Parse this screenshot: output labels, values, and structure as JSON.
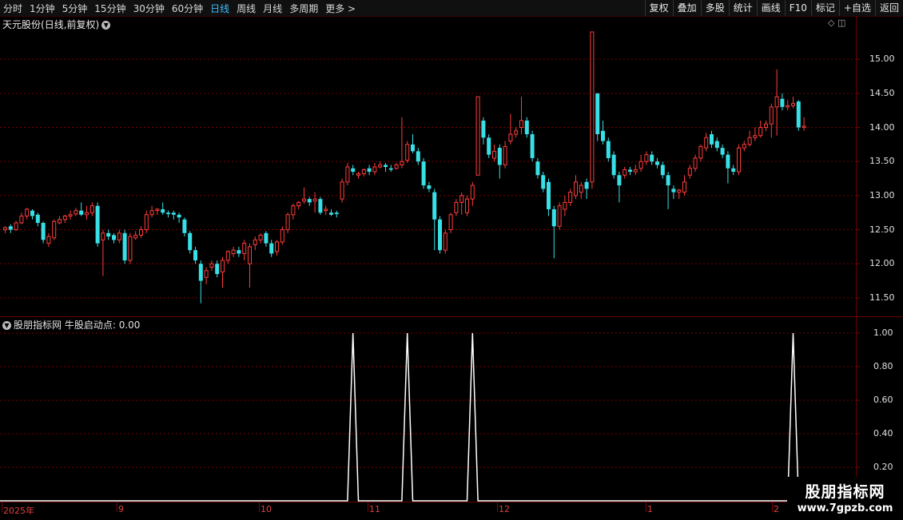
{
  "toolbar": {
    "periods": [
      "分时",
      "1分钟",
      "5分钟",
      "15分钟",
      "30分钟",
      "60分钟",
      "日线",
      "周线",
      "月线",
      "多周期",
      "更多 >"
    ],
    "active_period": "日线",
    "buttons": [
      "复权",
      "叠加",
      "多股",
      "统计",
      "画线",
      "F10",
      "标记",
      "+自选",
      "返回"
    ]
  },
  "stock": {
    "name": "天元股份",
    "chart_mode": "(日线,前复权)"
  },
  "price_axis": {
    "labels": [
      "15.00",
      "14.50",
      "14.00",
      "13.50",
      "13.00",
      "12.50",
      "12.00",
      "11.50"
    ],
    "min": 11.3,
    "max": 15.4
  },
  "indicator": {
    "name": "股朋指标网",
    "series_label": "牛股启动点: 0.00",
    "axis_labels": [
      "1.00",
      "0.80",
      "0.60",
      "0.40",
      "0.20"
    ]
  },
  "time_axis": {
    "labels": [
      "2025年",
      "9",
      "10",
      "11",
      "12",
      "1",
      "2"
    ]
  },
  "watermark": {
    "main": "股朋指标网",
    "url": "www.7gpzb.com"
  },
  "colors": {
    "up": "#ff3c3c",
    "down": "#37e0e6",
    "doji": "#ffffff",
    "indicator": "#ffffff",
    "grid": "#7a0000",
    "background": "#000000"
  },
  "chart_data": {
    "type": "candlestick",
    "series": [
      {
        "name": "K线",
        "ohlc": [
          [
            12.5,
            12.53,
            12.45,
            12.55
          ],
          [
            12.55,
            12.5,
            12.45,
            12.58
          ],
          [
            12.5,
            12.6,
            12.48,
            12.63
          ],
          [
            12.6,
            12.7,
            12.58,
            12.75
          ],
          [
            12.7,
            12.8,
            12.65,
            12.82
          ],
          [
            12.78,
            12.7,
            12.65,
            12.8
          ],
          [
            12.72,
            12.6,
            12.55,
            12.75
          ],
          [
            12.6,
            12.35,
            12.3,
            12.62
          ],
          [
            12.3,
            12.4,
            12.25,
            12.45
          ],
          [
            12.38,
            12.62,
            12.35,
            12.65
          ],
          [
            12.6,
            12.65,
            12.58,
            12.7
          ],
          [
            12.65,
            12.7,
            12.6,
            12.72
          ],
          [
            12.7,
            12.72,
            12.65,
            12.78
          ],
          [
            12.73,
            12.78,
            12.7,
            12.82
          ],
          [
            12.78,
            12.72,
            12.7,
            12.9
          ],
          [
            12.72,
            12.75,
            12.65,
            12.85
          ],
          [
            12.75,
            12.85,
            12.7,
            12.9
          ],
          [
            12.85,
            12.3,
            12.25,
            12.9
          ],
          [
            12.35,
            12.45,
            11.82,
            12.5
          ],
          [
            12.45,
            12.4,
            12.35,
            12.5
          ],
          [
            12.42,
            12.35,
            12.3,
            12.45
          ],
          [
            12.35,
            12.45,
            12.3,
            12.5
          ],
          [
            12.45,
            12.05,
            12.0,
            12.5
          ],
          [
            12.05,
            12.4,
            12.0,
            12.45
          ],
          [
            12.38,
            12.42,
            12.35,
            12.48
          ],
          [
            12.42,
            12.5,
            12.38,
            12.55
          ],
          [
            12.5,
            12.72,
            12.45,
            12.78
          ],
          [
            12.72,
            12.78,
            12.68,
            12.85
          ],
          [
            12.78,
            12.8,
            12.72,
            12.82
          ],
          [
            12.8,
            12.75,
            12.72,
            12.9
          ],
          [
            12.75,
            12.73,
            12.68,
            12.78
          ],
          [
            12.75,
            12.72,
            12.65,
            12.78
          ],
          [
            12.72,
            12.68,
            12.6,
            12.75
          ],
          [
            12.65,
            12.45,
            12.4,
            12.68
          ],
          [
            12.45,
            12.2,
            12.15,
            12.48
          ],
          [
            12.2,
            12.05,
            12.0,
            12.25
          ],
          [
            12.0,
            11.75,
            11.42,
            12.05
          ],
          [
            11.8,
            11.9,
            11.7,
            11.95
          ],
          [
            11.95,
            12.0,
            11.9,
            12.05
          ],
          [
            12.0,
            11.85,
            11.8,
            12.05
          ],
          [
            11.88,
            12.05,
            11.65,
            12.1
          ],
          [
            12.05,
            12.18,
            12.0,
            12.2
          ],
          [
            12.15,
            12.2,
            12.1,
            12.25
          ],
          [
            12.2,
            12.15,
            12.1,
            12.25
          ],
          [
            12.15,
            12.3,
            12.05,
            12.35
          ],
          [
            12.0,
            12.25,
            11.65,
            12.3
          ],
          [
            12.28,
            12.35,
            12.2,
            12.4
          ],
          [
            12.35,
            12.42,
            12.3,
            12.45
          ],
          [
            12.45,
            12.3,
            12.25,
            12.48
          ],
          [
            12.3,
            12.15,
            12.1,
            12.35
          ],
          [
            12.18,
            12.32,
            12.12,
            12.35
          ],
          [
            12.32,
            12.5,
            12.28,
            12.55
          ],
          [
            12.5,
            12.72,
            12.45,
            12.75
          ],
          [
            12.72,
            12.85,
            12.65,
            12.88
          ],
          [
            12.85,
            12.9,
            12.8,
            12.92
          ],
          [
            12.92,
            12.95,
            12.88,
            13.12
          ],
          [
            12.95,
            12.9,
            12.85,
            12.98
          ],
          [
            12.92,
            12.95,
            12.75,
            13.05
          ],
          [
            12.95,
            12.75,
            12.72,
            12.98
          ],
          [
            12.78,
            12.8,
            12.72,
            12.85
          ],
          [
            12.75,
            12.72,
            12.7,
            12.8
          ],
          [
            12.75,
            12.73,
            12.68,
            12.78
          ],
          [
            12.95,
            13.2,
            12.9,
            13.25
          ],
          [
            13.2,
            13.42,
            13.15,
            13.48
          ],
          [
            13.4,
            13.35,
            13.3,
            13.45
          ],
          [
            13.3,
            13.32,
            13.25,
            13.35
          ],
          [
            13.32,
            13.38,
            13.28,
            13.4
          ],
          [
            13.4,
            13.35,
            13.3,
            13.45
          ],
          [
            13.35,
            13.42,
            13.3,
            13.48
          ],
          [
            13.42,
            13.45,
            13.4,
            13.5
          ],
          [
            13.45,
            13.42,
            13.35,
            13.48
          ],
          [
            13.4,
            13.38,
            13.35,
            13.45
          ],
          [
            13.4,
            13.45,
            13.38,
            13.48
          ],
          [
            13.45,
            13.5,
            13.4,
            14.15
          ],
          [
            13.52,
            13.75,
            13.48,
            13.8
          ],
          [
            13.75,
            13.65,
            13.62,
            13.9
          ],
          [
            13.65,
            13.5,
            13.45,
            13.7
          ],
          [
            13.5,
            13.15,
            13.1,
            13.55
          ],
          [
            13.15,
            13.1,
            13.05,
            13.2
          ],
          [
            13.05,
            12.65,
            12.2,
            13.1
          ],
          [
            12.65,
            12.2,
            12.15,
            12.7
          ],
          [
            12.2,
            12.45,
            12.15,
            12.5
          ],
          [
            12.5,
            12.72,
            12.45,
            12.75
          ],
          [
            12.75,
            12.9,
            12.7,
            12.95
          ],
          [
            12.9,
            13.0,
            12.72,
            13.05
          ],
          [
            12.75,
            12.95,
            12.7,
            13.0
          ],
          [
            12.95,
            13.15,
            12.85,
            13.2
          ],
          [
            13.3,
            14.45,
            13.3,
            14.45
          ],
          [
            14.1,
            13.85,
            13.75,
            14.15
          ],
          [
            13.85,
            13.6,
            13.55,
            13.9
          ],
          [
            13.55,
            13.65,
            13.5,
            13.75
          ],
          [
            13.7,
            13.45,
            13.25,
            13.75
          ],
          [
            13.45,
            13.72,
            13.4,
            13.8
          ],
          [
            13.8,
            13.9,
            13.75,
            14.2
          ],
          [
            13.9,
            13.95,
            13.85,
            14.0
          ],
          [
            14.0,
            14.1,
            13.9,
            14.45
          ],
          [
            14.1,
            13.9,
            13.85,
            14.15
          ],
          [
            13.9,
            13.55,
            13.5,
            13.95
          ],
          [
            13.5,
            13.3,
            13.25,
            13.55
          ],
          [
            13.3,
            13.1,
            13.05,
            13.35
          ],
          [
            13.2,
            12.8,
            12.7,
            13.25
          ],
          [
            12.8,
            12.55,
            12.08,
            12.85
          ],
          [
            12.55,
            12.85,
            12.5,
            12.9
          ],
          [
            12.8,
            12.9,
            12.7,
            13.0
          ],
          [
            12.9,
            13.05,
            12.85,
            13.1
          ],
          [
            13.0,
            13.2,
            12.95,
            13.3
          ],
          [
            13.05,
            13.15,
            12.95,
            13.2
          ],
          [
            13.2,
            13.1,
            12.95,
            13.25
          ],
          [
            13.2,
            15.4,
            13.1,
            15.4
          ],
          [
            14.5,
            13.9,
            13.8,
            14.5
          ],
          [
            13.95,
            13.8,
            13.75,
            14.1
          ],
          [
            13.8,
            13.55,
            13.5,
            13.85
          ],
          [
            13.6,
            13.3,
            13.25,
            13.65
          ],
          [
            13.3,
            13.15,
            12.9,
            13.35
          ],
          [
            13.3,
            13.38,
            13.25,
            13.42
          ],
          [
            13.38,
            13.35,
            13.3,
            13.42
          ],
          [
            13.35,
            13.38,
            13.3,
            13.45
          ],
          [
            13.4,
            13.5,
            13.35,
            13.6
          ],
          [
            13.5,
            13.6,
            13.45,
            13.65
          ],
          [
            13.6,
            13.5,
            13.45,
            13.65
          ],
          [
            13.5,
            13.45,
            13.4,
            13.55
          ],
          [
            13.45,
            13.3,
            13.25,
            13.5
          ],
          [
            13.3,
            13.15,
            12.8,
            13.35
          ],
          [
            13.1,
            13.05,
            12.95,
            13.15
          ],
          [
            13.05,
            13.08,
            12.95,
            13.1
          ],
          [
            13.05,
            13.2,
            13.0,
            13.3
          ],
          [
            13.3,
            13.4,
            13.25,
            13.45
          ],
          [
            13.4,
            13.55,
            13.35,
            13.6
          ],
          [
            13.55,
            13.72,
            13.5,
            13.75
          ],
          [
            13.7,
            13.85,
            13.65,
            13.92
          ],
          [
            13.9,
            13.75,
            13.7,
            13.95
          ],
          [
            13.8,
            13.7,
            13.65,
            13.85
          ],
          [
            13.7,
            13.6,
            13.55,
            13.75
          ],
          [
            13.6,
            13.4,
            13.18,
            13.65
          ],
          [
            13.4,
            13.35,
            13.3,
            13.45
          ],
          [
            13.35,
            13.7,
            13.3,
            13.75
          ],
          [
            13.7,
            13.75,
            13.65,
            13.8
          ],
          [
            13.75,
            13.85,
            13.72,
            13.95
          ],
          [
            13.85,
            13.88,
            13.8,
            14.0
          ],
          [
            13.88,
            14.0,
            13.85,
            14.1
          ],
          [
            14.0,
            14.05,
            13.95,
            14.1
          ],
          [
            14.05,
            14.3,
            13.85,
            14.35
          ],
          [
            14.3,
            14.45,
            13.88,
            14.85
          ],
          [
            14.42,
            14.3,
            14.25,
            14.5
          ],
          [
            14.3,
            14.32,
            14.25,
            14.4
          ],
          [
            14.32,
            14.35,
            14.28,
            14.45
          ],
          [
            14.38,
            14.0,
            13.95,
            14.4
          ],
          [
            14.0,
            14.02,
            13.95,
            14.15
          ]
        ]
      }
    ],
    "indicator_series": {
      "name": "牛股启动点",
      "signal_indices": [
        64,
        74,
        86,
        145
      ],
      "values_at_signal": 1.0
    },
    "ylim": [
      11.3,
      15.4
    ]
  }
}
